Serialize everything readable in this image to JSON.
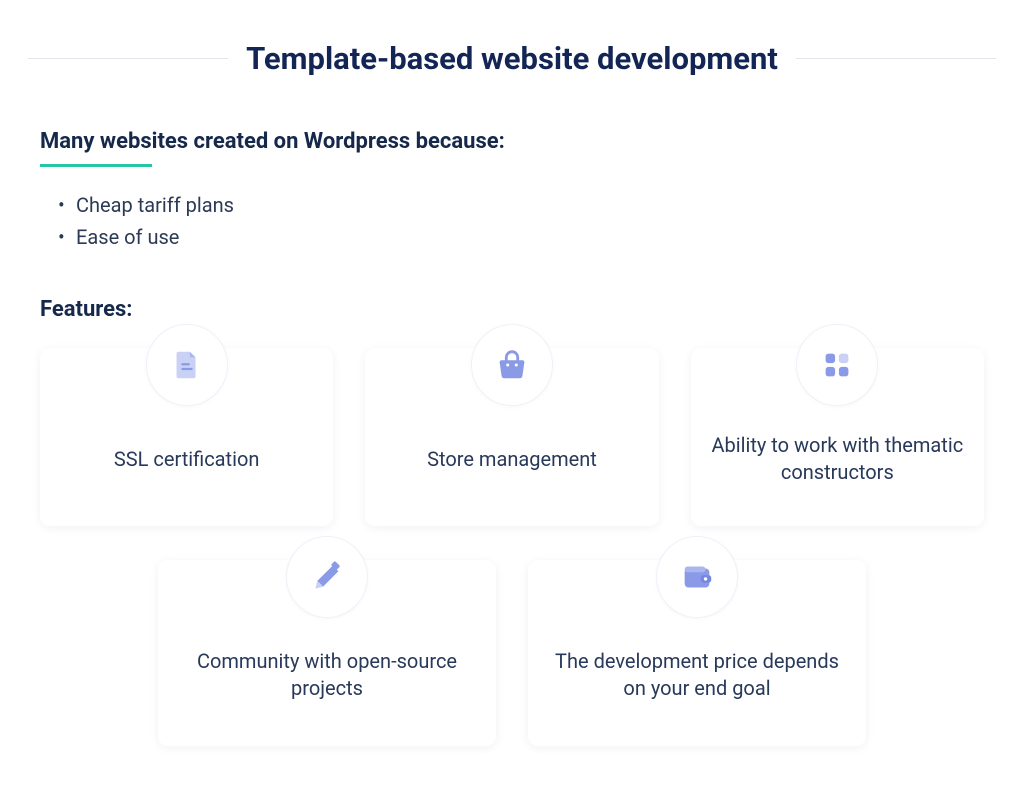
{
  "title": "Template-based website development",
  "intro": {
    "heading": "Many websites created on Wordpress because:",
    "bullets": [
      "Cheap tariff plans",
      "Ease of use"
    ]
  },
  "features": {
    "heading": "Features:",
    "cards": [
      {
        "label": "SSL certification",
        "icon": "document-icon"
      },
      {
        "label": "Store management",
        "icon": "bag-icon"
      },
      {
        "label": "Ability to work with thematic constructors",
        "icon": "tiles-icon"
      },
      {
        "label": "Community with open-source projects",
        "icon": "pencil-icon"
      },
      {
        "label": "The development price depends on your end goal",
        "icon": "wallet-icon"
      }
    ]
  },
  "colors": {
    "accent": "#27c4a8",
    "icon": "#8b9ae6",
    "text": "#1a2b4c"
  }
}
